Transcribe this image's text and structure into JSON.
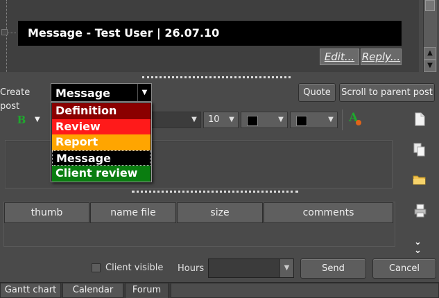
{
  "message": {
    "header": "Message - Test User | 26.07.10",
    "edit_label": "Edit...",
    "reply_label": "Reply..."
  },
  "composer": {
    "create_post_label": "Create post",
    "post_type_value": "Message",
    "post_type_options": [
      "Definition",
      "Review",
      "Report",
      "Message",
      "Client review"
    ],
    "option_colors": [
      "#8b0000",
      "#ff1a1a",
      "#ffa500",
      "#000000",
      "#0a7d10"
    ],
    "quote_label": "Quote",
    "scroll_to_parent_label": "Scroll to parent post"
  },
  "toolbar": {
    "bold_label": "B",
    "font_size": "10",
    "font_color_label": "A"
  },
  "attachments": {
    "columns": [
      "thumb",
      "name file",
      "size",
      "comments"
    ]
  },
  "footer": {
    "client_visible_label": "Client visible",
    "hours_label": "Hours",
    "send_label": "Send",
    "cancel_label": "Cancel"
  },
  "tabs": [
    "Gantt chart",
    "Calendar",
    "Forum"
  ],
  "side_icons": [
    "new-document-icon",
    "copy-icon",
    "folder-icon",
    "print-icon",
    "expand-down-icon"
  ]
}
